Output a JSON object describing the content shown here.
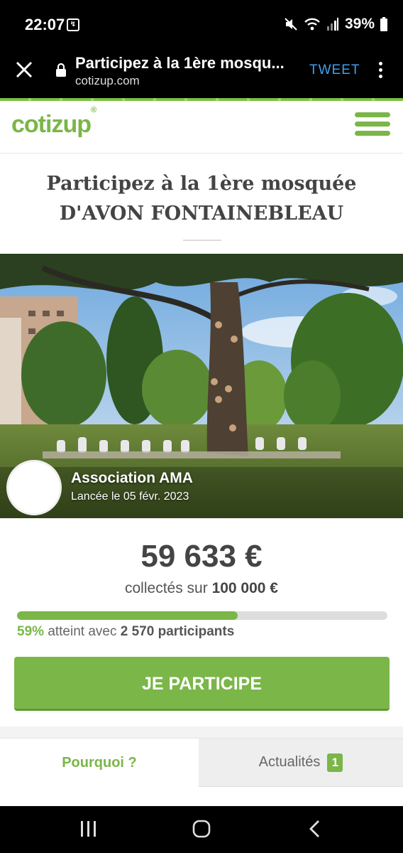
{
  "status_bar": {
    "time": "22:07",
    "battery": "39%",
    "icons": [
      "mute-icon",
      "wifi-icon",
      "signal-icon",
      "battery-icon"
    ]
  },
  "browser": {
    "page_title": "Participez à la 1ère mosqu...",
    "url": "cotizup.com",
    "tweet_label": "TWEET"
  },
  "site": {
    "logo_text": "cotizup",
    "logo_mark": "®",
    "brand_color": "#7ab648"
  },
  "campaign": {
    "title_line1": "Participez à la 1ère mosquée",
    "title_line2": "D'AVON FONTAINEBLEAU",
    "association": "Association AMA",
    "launch_date": "Lancée le 05 févr. 2023",
    "amount_collected": "59 633 €",
    "collected_prefix": "collectés sur",
    "goal": "100 000 €",
    "progress_fraction": 0.5963,
    "percent_label": "59%",
    "reached_text": "atteint avec",
    "participants": "2 570 participants",
    "cta_label": "JE PARTICIPE"
  },
  "tabs": [
    {
      "label": "Pourquoi ?",
      "active": true
    },
    {
      "label": "Actualités",
      "badge": "1",
      "active": false
    }
  ]
}
